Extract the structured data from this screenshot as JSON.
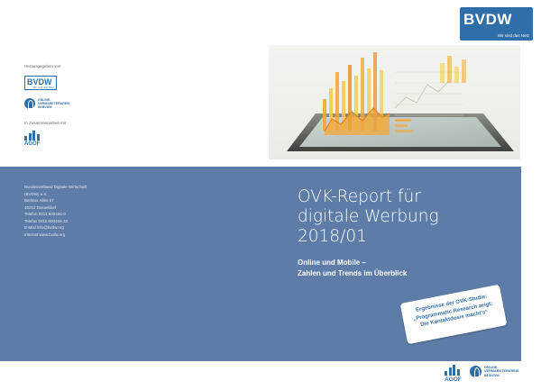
{
  "brand": {
    "name": "BVDW",
    "tagline": "Wir sind das Netz",
    "color": "#2f6ea8"
  },
  "publisher": {
    "label": "Herausgegeben von",
    "partner_label": "In Zusammenarbeit mit",
    "ovk_name": [
      "ONLINE-",
      "VERMARKTERKREIS",
      "IM BVDW"
    ],
    "agof_name": "AGOF"
  },
  "address": {
    "lines": [
      "Bundesverband Digitale Wirtschaft",
      "(BVDW) e.V.",
      "Berliner Allee 57",
      "40212 Düsseldorf",
      "Telefon 0211 600456-0",
      "Telefax 0211 600456-33",
      "E-Mail   info@bvdw.org",
      "Internet www.bvdw.org"
    ]
  },
  "report": {
    "title_lines": [
      "OVK-Report für",
      "digitale Werbung",
      "2018/01"
    ],
    "subtitle_lines": [
      "Online und Mobile –",
      "Zahlen und Trends im Überblick"
    ]
  },
  "sticker": {
    "lines": [
      "Ergebnisse der OVK-Studie:",
      "„Programmatic Research zeigt:",
      "Die Kontaktdosis macht’s“"
    ]
  },
  "colors": {
    "band": "#5e7ca8",
    "accent_orange": "#f2a637",
    "accent_yellow": "#f7c94b"
  }
}
